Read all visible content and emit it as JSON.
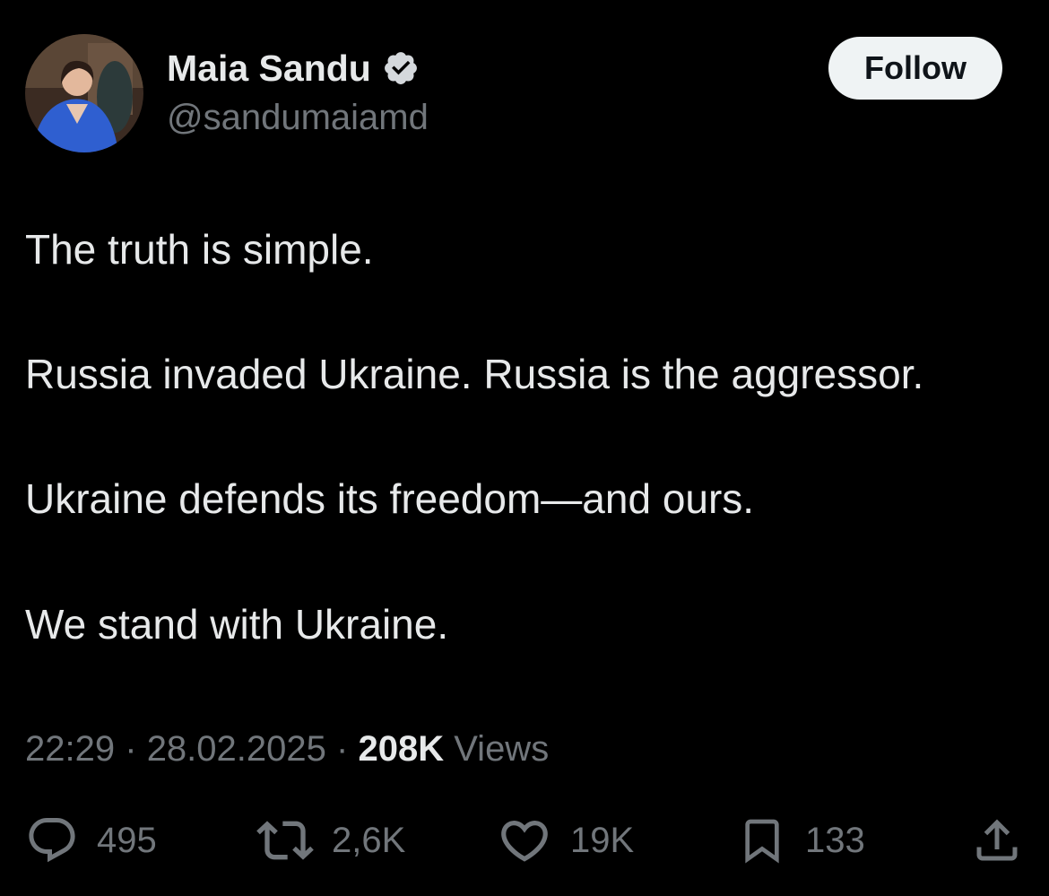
{
  "user": {
    "display_name": "Maia Sandu",
    "handle": "@sandumaiamd",
    "verified_icon": "verified-badge-icon",
    "avatar": "profile-photo"
  },
  "follow_button": {
    "label": "Follow"
  },
  "tweet": {
    "lines": [
      "The truth is simple.",
      "Russia invaded Ukraine. Russia is the aggressor.",
      "Ukraine defends its freedom—and ours.",
      "We stand with Ukraine."
    ]
  },
  "meta": {
    "time": "22:29",
    "separator": "·",
    "date": "28.02.2025",
    "views_count": "208K",
    "views_label": "Views"
  },
  "actions": {
    "reply": {
      "icon": "reply-icon",
      "count": "495"
    },
    "retweet": {
      "icon": "retweet-icon",
      "count": "2,6K"
    },
    "like": {
      "icon": "heart-icon",
      "count": "19K"
    },
    "bookmark": {
      "icon": "bookmark-icon",
      "count": "133"
    },
    "share": {
      "icon": "share-icon"
    }
  },
  "colors": {
    "background": "#000000",
    "primary_text": "#e7e9ea",
    "secondary_text": "#71767b",
    "follow_bg": "#eff3f4",
    "follow_text": "#0f1419",
    "verified_badge": "#d4d8dc"
  }
}
